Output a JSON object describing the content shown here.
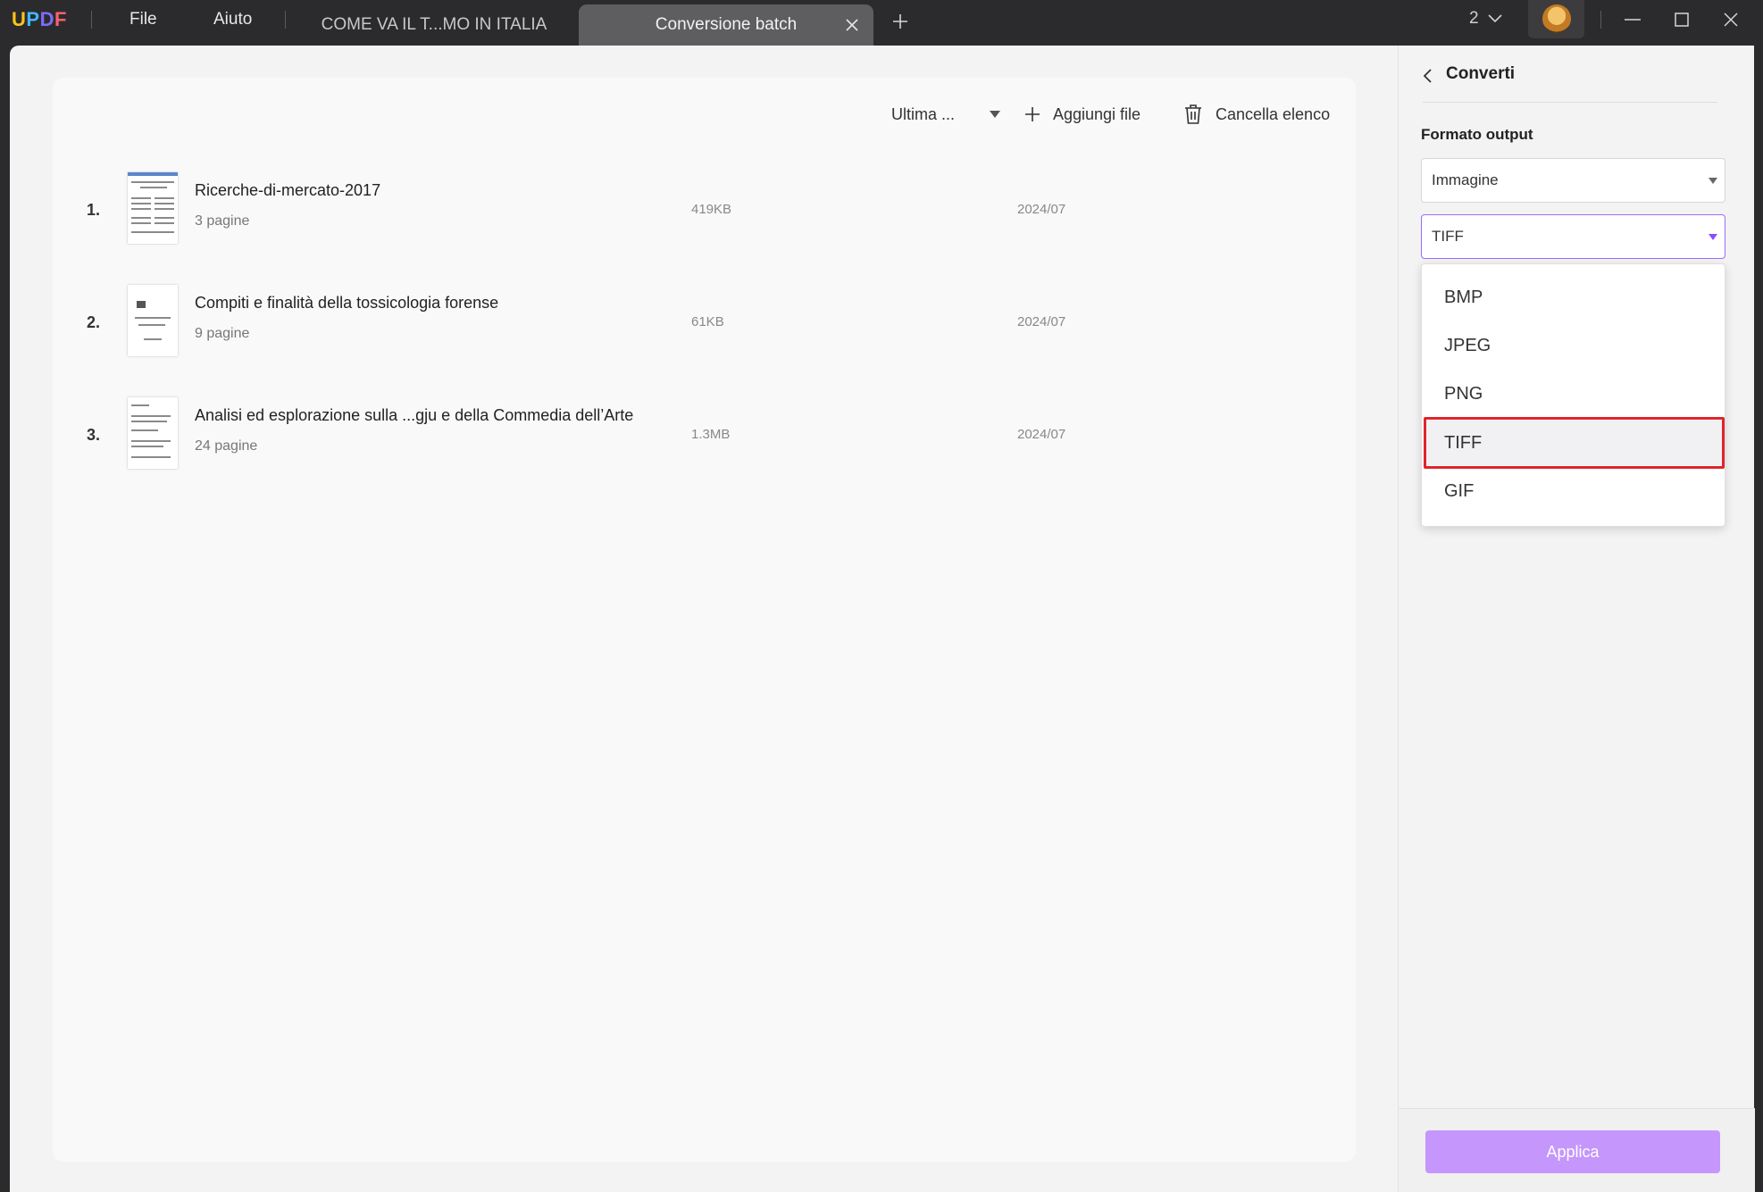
{
  "titlebar": {
    "logo": {
      "l1": "U",
      "l2": "P",
      "l3": "D",
      "l4": "F"
    },
    "menu": [
      {
        "label": "File"
      },
      {
        "label": "Aiuto"
      }
    ],
    "tabs": [
      {
        "label": "COME VA IL T...MO IN ITALIA",
        "active": false
      },
      {
        "label": "Conversione batch",
        "active": true
      }
    ],
    "window_count": "2"
  },
  "toolbar": {
    "sort_label": "Ultima ...",
    "add_files_label": "Aggiungi file",
    "clear_list_label": "Cancella elenco"
  },
  "files": [
    {
      "index": "1.",
      "name": "Ricerche-di-mercato-2017",
      "pages": "3 pagine",
      "size": "419KB",
      "date": "2024/07"
    },
    {
      "index": "2.",
      "name": "Compiti e finalità della tossicologia forense",
      "pages": "9 pagine",
      "size": "61KB",
      "date": "2024/07"
    },
    {
      "index": "3.",
      "name": "Analisi ed esplorazione sulla ...gju e della Commedia dell’Arte",
      "pages": "24 pagine",
      "size": "1.3MB",
      "date": "2024/07"
    }
  ],
  "side_panel": {
    "title": "Converti",
    "format_label": "Formato output",
    "category_value": "Immagine",
    "format_value": "TIFF",
    "format_options": [
      "BMP",
      "JPEG",
      "PNG",
      "TIFF",
      "GIF"
    ],
    "selected_option": "TIFF",
    "apply_label": "Applica"
  },
  "colors": {
    "accent": "#9b6bff",
    "apply_button": "#c596fb",
    "highlight_box": "#e0242b"
  }
}
